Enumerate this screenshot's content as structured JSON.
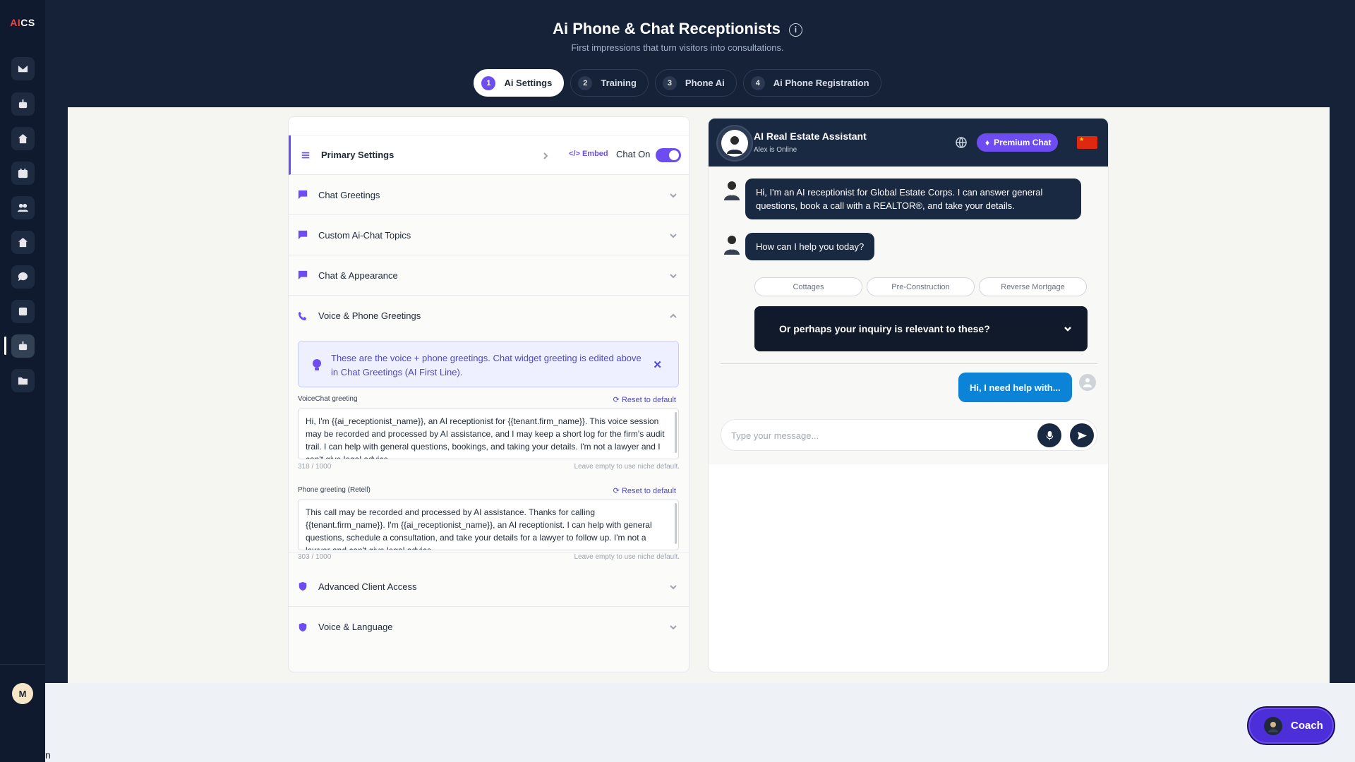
{
  "sidebar": {
    "logo": {
      "ai": "AI",
      "rest": "CS"
    },
    "avatar_initial": "M"
  },
  "header": {
    "title": "Ai Phone & Chat Receptionists",
    "info_glyph": "i",
    "subtitle": "First impressions that turn visitors into consultations."
  },
  "tabs": [
    {
      "num": "1",
      "label": "Ai Settings"
    },
    {
      "num": "2",
      "label": "Training"
    },
    {
      "num": "3",
      "label": "Phone Ai"
    },
    {
      "num": "4",
      "label": "Ai Phone Registration"
    }
  ],
  "settings": {
    "primary": {
      "label": "Primary Settings",
      "embed": "Embed",
      "chat_on": "Chat On"
    },
    "chat_greetings": "Chat Greetings",
    "custom_topics": "Custom Ai-Chat Topics",
    "chat_appearance": "Chat & Appearance",
    "voice": {
      "label": "Voice & Phone Greetings",
      "callout": "These are the voice + phone greetings. Chat widget greeting is edited above in Chat Greetings (AI First Line).",
      "voicechat_label": "VoiceChat greeting",
      "voicechat_value": "Hi, I'm {{ai_receptionist_name}}, an AI receptionist for {{tenant.firm_name}}. This voice session may be recorded and processed by AI assistance, and I may keep a short log for the firm's audit trail. I can help with general questions, bookings, and taking your details. I'm not a lawyer and I can't give legal advice.",
      "voicechat_count": "318 / 1000",
      "phone_label": "Phone greeting (Retell)",
      "phone_value": "This call may be recorded and processed by AI assistance. Thanks for calling {{tenant.firm_name}}. I'm {{ai_receptionist_name}}, an AI receptionist. I can help with general questions, schedule a consultation, and take your details for a lawyer to follow up. I'm not a lawyer and can't give legal advice.",
      "phone_count": "303 / 1000",
      "reset": "Reset to default",
      "hint": "Leave empty to use niche default."
    },
    "advanced_access": "Advanced Client Access",
    "voice_language": "Voice & Language"
  },
  "chat": {
    "title": "AI Real Estate Assistant",
    "status": "Alex is Online",
    "premium": "Premium Chat",
    "msg1": "Hi, I'm an AI receptionist for Global Estate Corps. I can answer general questions, book a call with a REALTOR®, and take your details.",
    "msg2": "How can I help you today?",
    "chips": [
      "Cottages",
      "Pre-Construction",
      "Reverse Mortgage"
    ],
    "inquiry": "Or perhaps your inquiry is relevant to these?",
    "user_msg": "Hi, I need help with...",
    "placeholder": "Type your message..."
  },
  "coach": "Coach",
  "bottom_glyph": "n",
  "colors": {
    "accent": "#6d4df2",
    "navy": "#152238",
    "user_bubble": "#0b84d8"
  }
}
